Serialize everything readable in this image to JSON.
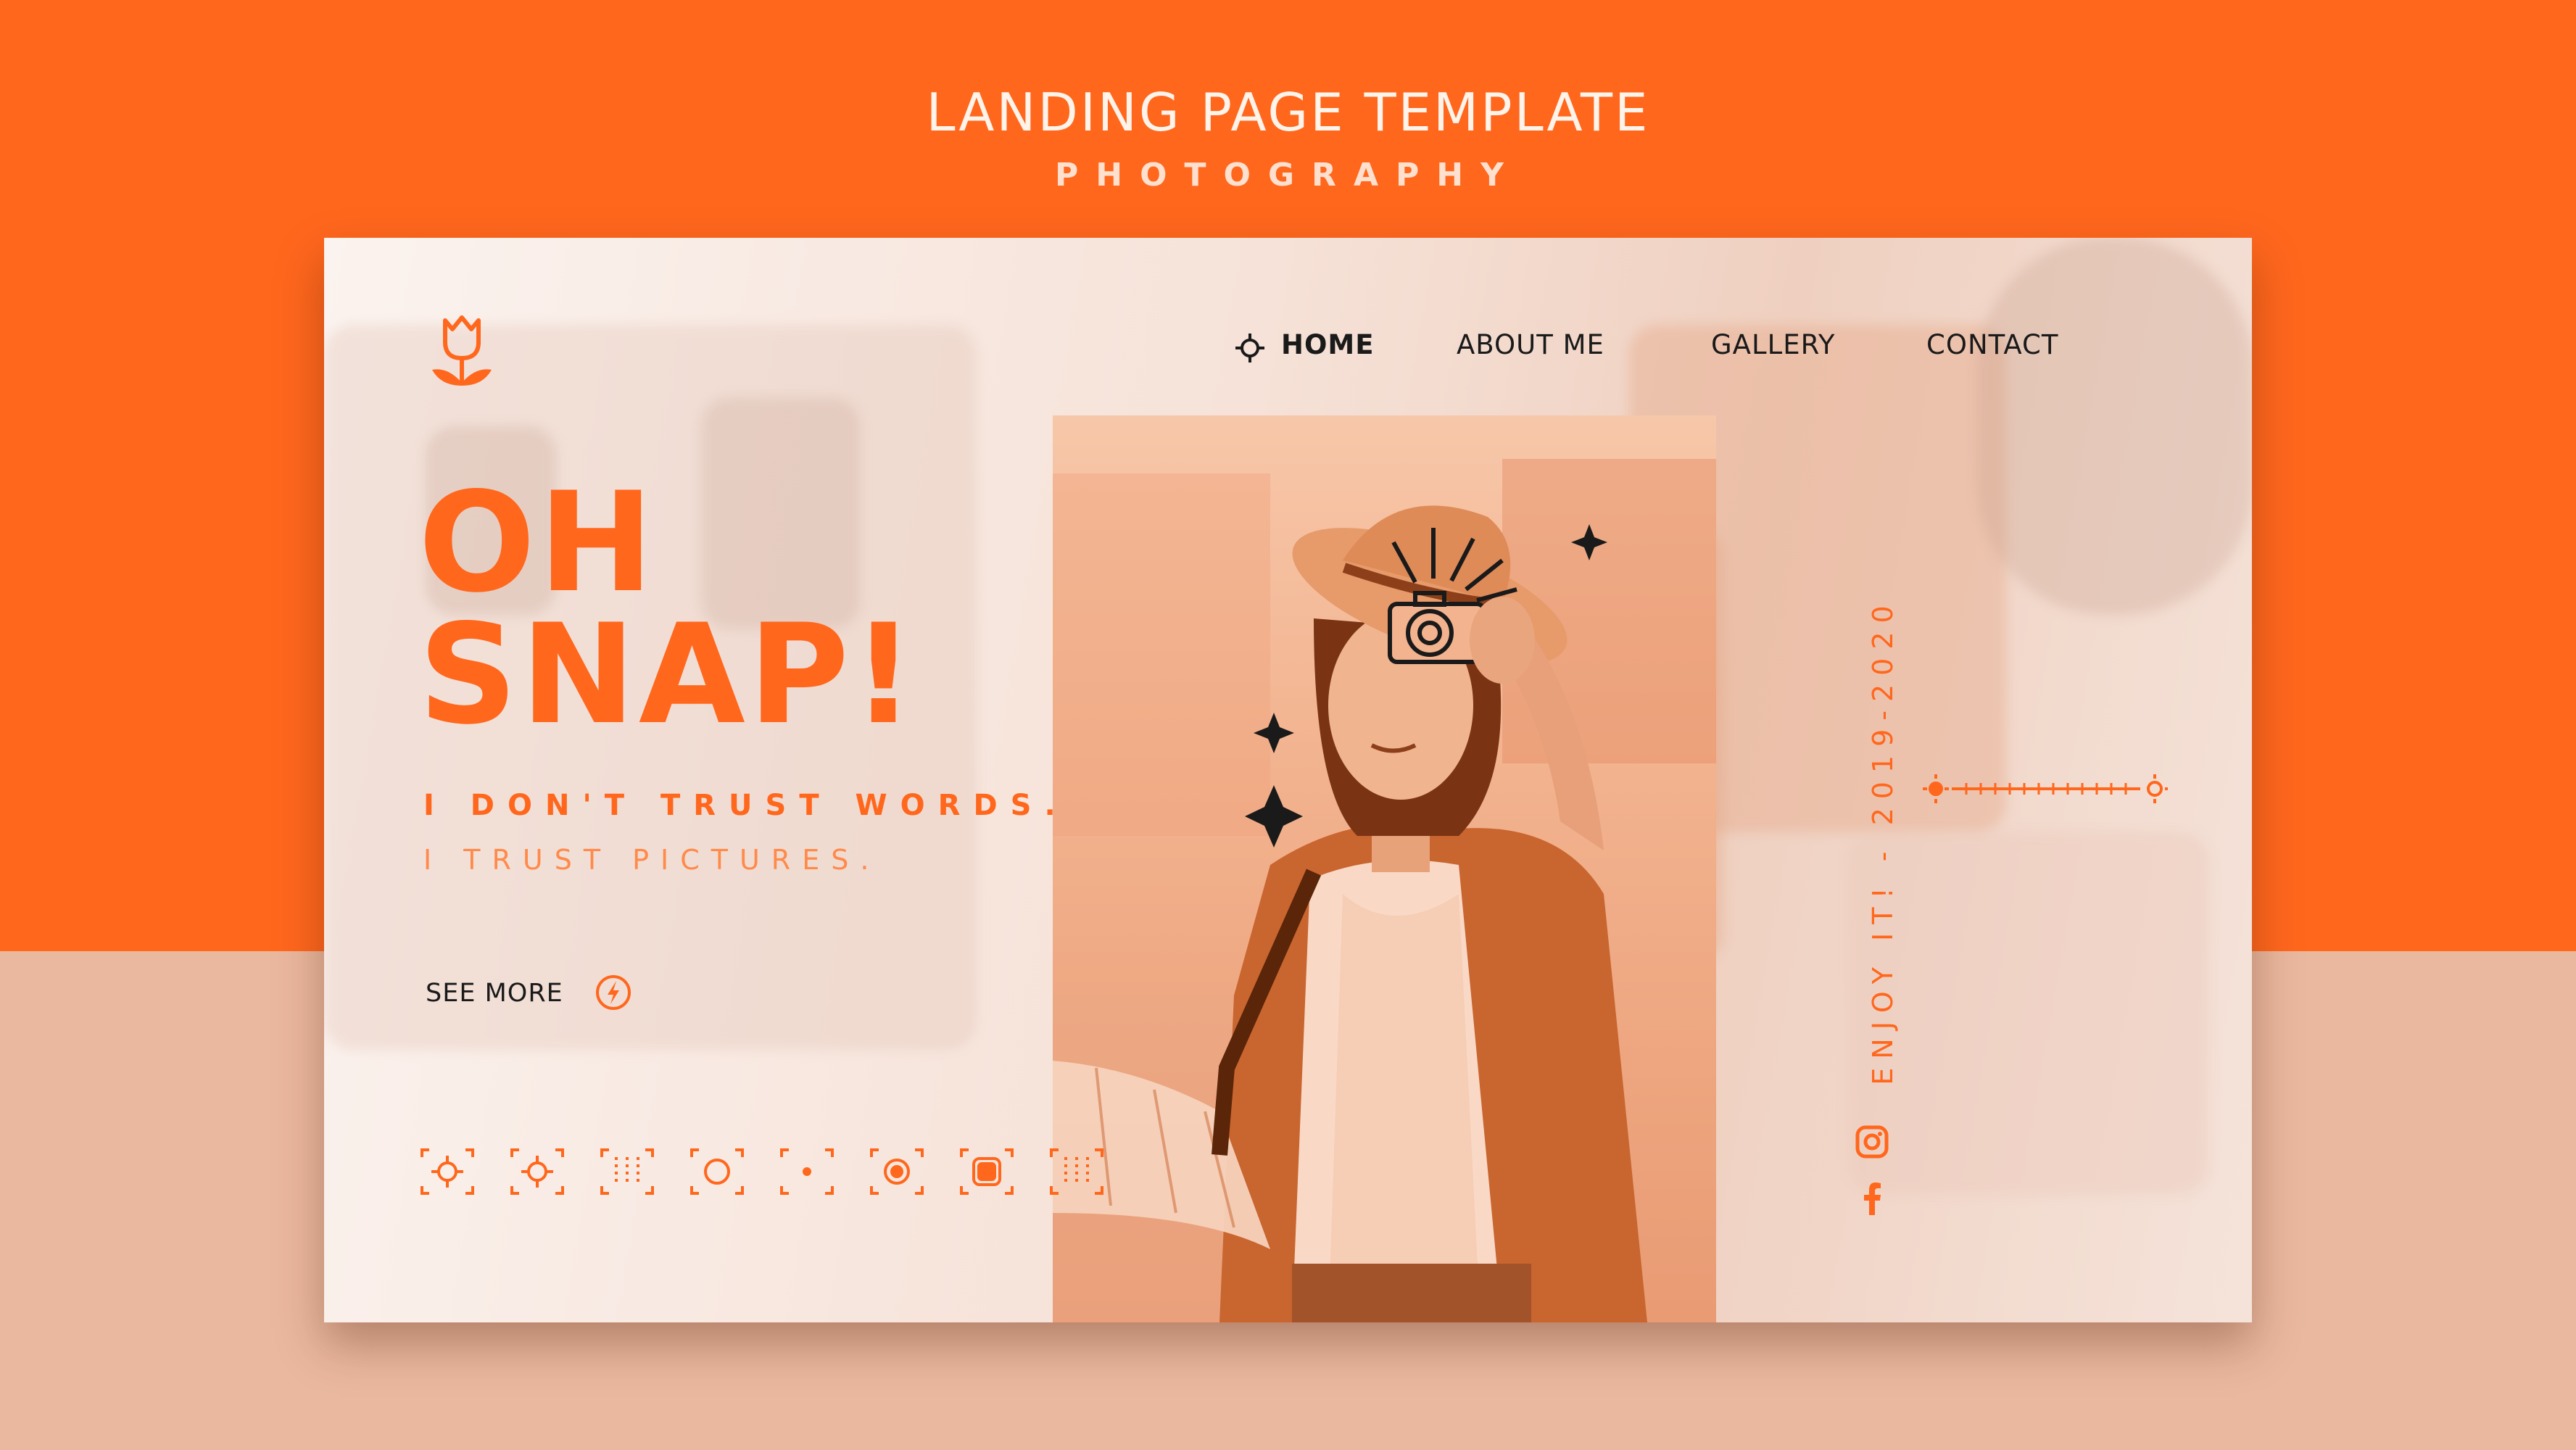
{
  "page": {
    "title": "LANDING PAGE TEMPLATE",
    "subtitle": "PHOTOGRAPHY"
  },
  "colors": {
    "accent": "#ff671d",
    "accent_light": "#eab89e",
    "text_dark": "#1a1a1a"
  },
  "nav": {
    "items": [
      {
        "label": "HOME",
        "active": true,
        "icon": "crosshair-icon"
      },
      {
        "label": "ABOUT ME",
        "active": false
      },
      {
        "label": "GALLERY",
        "active": false
      },
      {
        "label": "CONTACT",
        "active": false
      }
    ]
  },
  "hero": {
    "title_line1": "OH",
    "title_line2": "SNAP!",
    "tagline1": "I DON'T TRUST WORDS.",
    "tagline2": "I TRUST PICTURES.",
    "cta": "SEE MORE",
    "cta_icon": "lightning-icon"
  },
  "side": {
    "vertical_text": "ENJOY IT! - 2019-2020",
    "slider_icon": "sun-icon",
    "social": [
      "instagram-icon",
      "facebook-icon"
    ]
  },
  "logo": {
    "icon": "tulip-icon"
  },
  "filters": [
    "focus-icon",
    "focus-icon",
    "grid-icon",
    "circle-icon",
    "dot-icon",
    "ring-icon",
    "square-icon",
    "grid-icon"
  ]
}
